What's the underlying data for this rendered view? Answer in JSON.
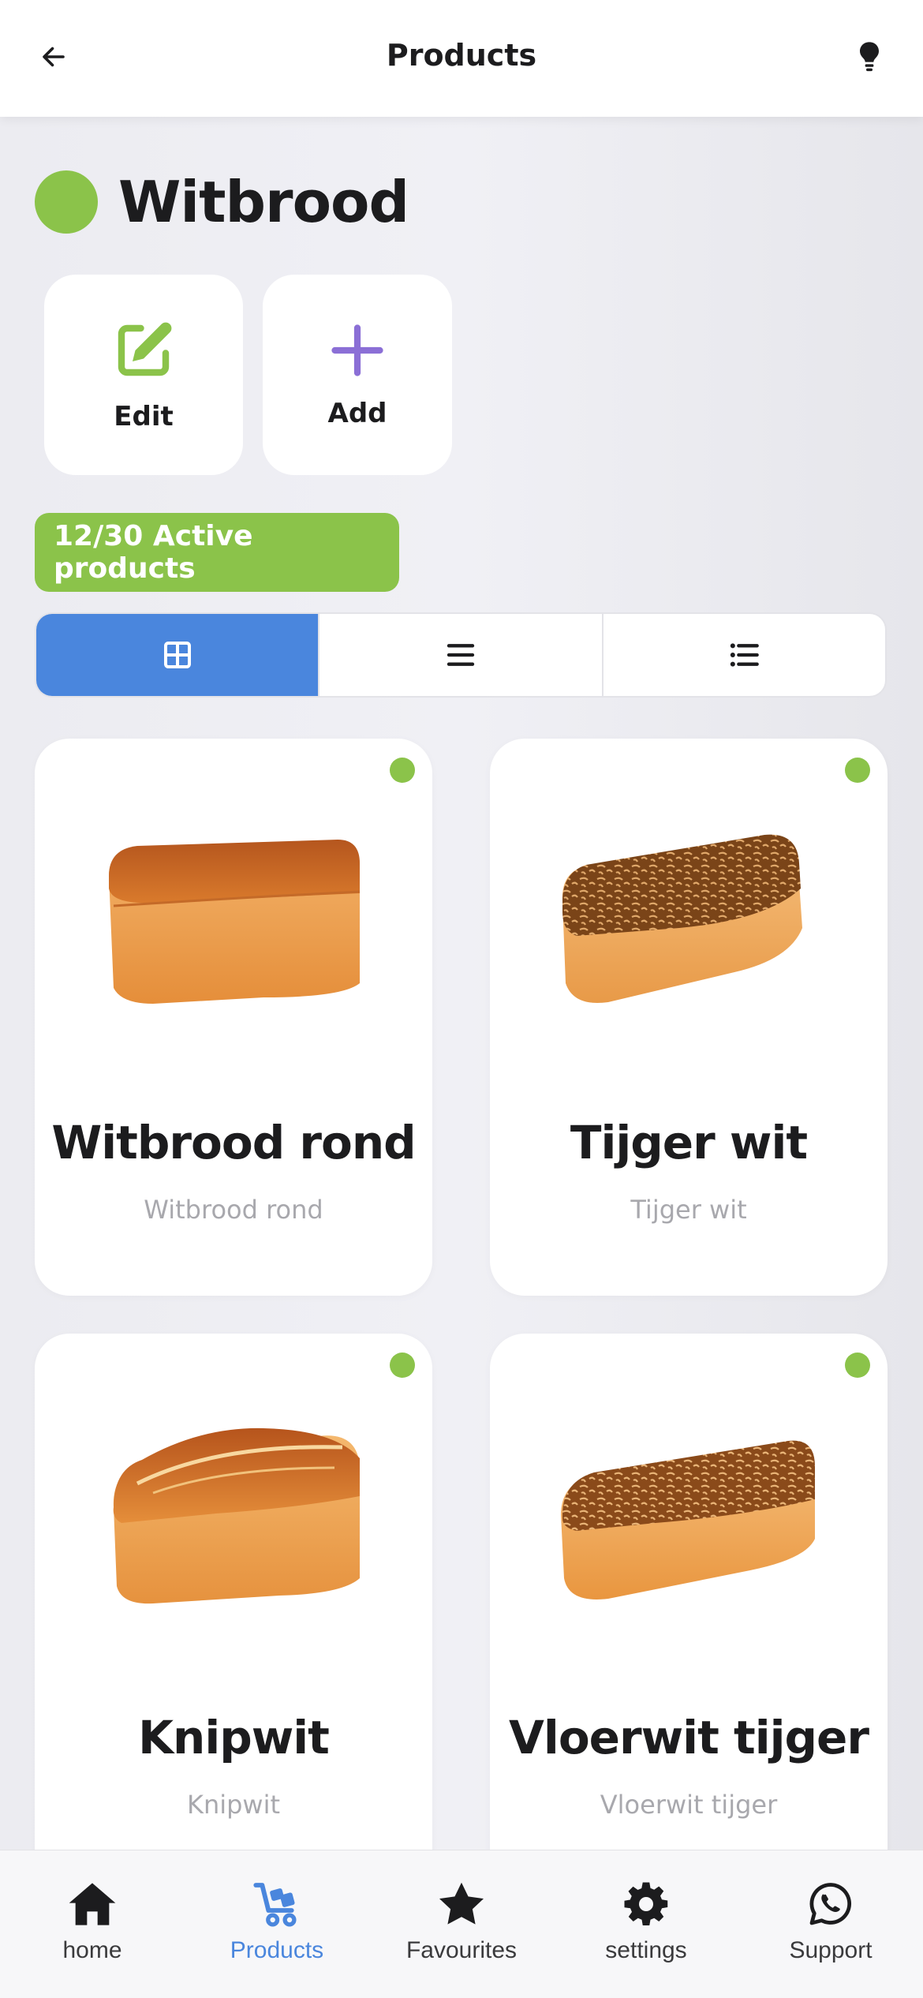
{
  "header": {
    "title": "Products",
    "back_icon": "arrow-left-icon",
    "tip_icon": "lightbulb-icon"
  },
  "category": {
    "name": "Witbrood",
    "status_color": "#8bc34a"
  },
  "actions": {
    "edit_label": "Edit",
    "add_label": "Add"
  },
  "active_products": {
    "label": "12/30 Active products",
    "active": 12,
    "total": 30
  },
  "view_modes": {
    "selected": "grid",
    "options": [
      "grid-icon",
      "list-icon",
      "detailed-list-icon"
    ]
  },
  "products": [
    {
      "name": "Witbrood rond",
      "subtitle": "Witbrood rond",
      "active": true
    },
    {
      "name": "Tijger wit",
      "subtitle": "Tijger wit",
      "active": true
    },
    {
      "name": "Knipwit",
      "subtitle": "Knipwit",
      "active": true
    },
    {
      "name": "Vloerwit tijger",
      "subtitle": "Vloerwit tijger",
      "active": true
    }
  ],
  "nav": {
    "items": [
      {
        "label": "home",
        "icon": "home-icon",
        "active": false
      },
      {
        "label": "Products",
        "icon": "cart-icon",
        "active": true
      },
      {
        "label": "Favourites",
        "icon": "star-icon",
        "active": false
      },
      {
        "label": "settings",
        "icon": "gear-icon",
        "active": false
      },
      {
        "label": "Support",
        "icon": "whatsapp-icon",
        "active": false
      }
    ]
  },
  "colors": {
    "accent_blue": "#4a86dd",
    "active_green": "#8bc34a",
    "add_purple": "#8b6fd6"
  }
}
